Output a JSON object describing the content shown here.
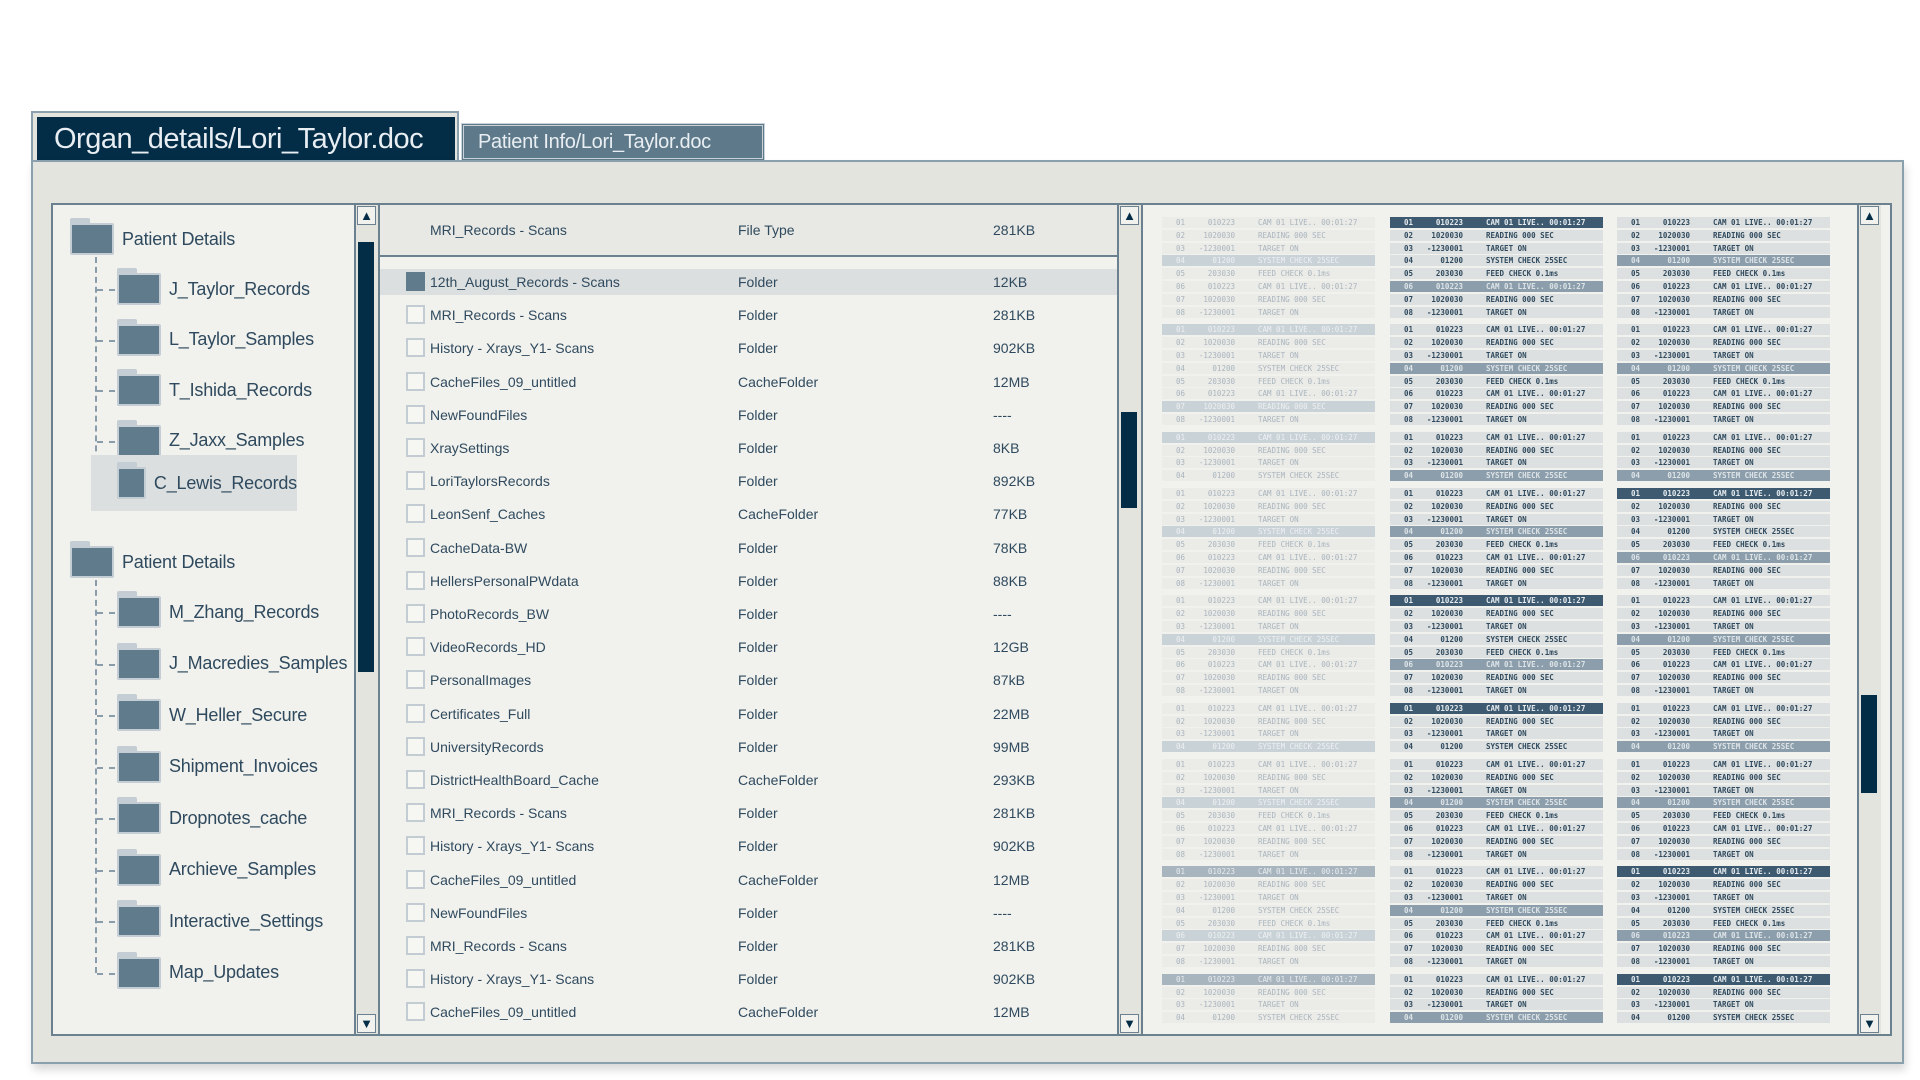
{
  "tabs": [
    {
      "label": "Organ_details/Lori_Taylor.doc",
      "active": true
    },
    {
      "label": "Patient Info/Lori_Taylor.doc",
      "active": false
    }
  ],
  "sidebar": {
    "groups": [
      {
        "label": "Patient Details",
        "children": [
          "J_Taylor_Records",
          "L_Taylor_Samples",
          "T_Ishida_Records",
          "Z_Jaxx_Samples",
          "C_Lewis_Records"
        ],
        "selected": "C_Lewis_Records"
      },
      {
        "label": "Patient Details",
        "children": [
          "M_Zhang_Records",
          "J_Macredies_Samples",
          "W_Heller_Secure",
          "Shipment_Invoices",
          "Dropnotes_cache",
          "Archieve_Samples",
          "Interactive_Settings",
          "Map_Updates"
        ]
      }
    ]
  },
  "list": {
    "header": {
      "name": "MRI_Records - Scans",
      "type": "File Type",
      "size": "281KB"
    },
    "rows": [
      {
        "name": "12th_August_Records - Scans",
        "type": "Folder",
        "size": "12KB",
        "checked": true
      },
      {
        "name": "MRI_Records - Scans",
        "type": "Folder",
        "size": "281KB"
      },
      {
        "name": "History - Xrays_Y1- Scans",
        "type": "Folder",
        "size": "902KB"
      },
      {
        "name": "CacheFiles_09_untitled",
        "type": "CacheFolder",
        "size": "12MB"
      },
      {
        "name": "NewFoundFiles",
        "type": "Folder",
        "size": "----"
      },
      {
        "name": "XraySettings",
        "type": "Folder",
        "size": "8KB"
      },
      {
        "name": "LoriTaylorsRecords",
        "type": "Folder",
        "size": "892KB"
      },
      {
        "name": "LeonSenf_Caches",
        "type": "CacheFolder",
        "size": "77KB"
      },
      {
        "name": "CacheData-BW",
        "type": "Folder",
        "size": "78KB"
      },
      {
        "name": "HellersPersonalPWdata",
        "type": "Folder",
        "size": "88KB"
      },
      {
        "name": "PhotoRecords_BW",
        "type": "Folder",
        "size": "----"
      },
      {
        "name": "VideoRecords_HD",
        "type": "Folder",
        "size": "12GB"
      },
      {
        "name": "PersonalImages",
        "type": "Folder",
        "size": "87kB"
      },
      {
        "name": "Certificates_Full",
        "type": "Folder",
        "size": "22MB"
      },
      {
        "name": "UniversityRecords",
        "type": "Folder",
        "size": "99MB"
      },
      {
        "name": "DistrictHealthBoard_Cache",
        "type": "CacheFolder",
        "size": "293KB"
      },
      {
        "name": "MRI_Records - Scans",
        "type": "Folder",
        "size": "281KB"
      },
      {
        "name": "History - Xrays_Y1- Scans",
        "type": "Folder",
        "size": "902KB"
      },
      {
        "name": "CacheFiles_09_untitled",
        "type": "CacheFolder",
        "size": "12MB"
      },
      {
        "name": "NewFoundFiles",
        "type": "Folder",
        "size": "----"
      },
      {
        "name": "MRI_Records - Scans",
        "type": "Folder",
        "size": "281KB"
      },
      {
        "name": "History - Xrays_Y1- Scans",
        "type": "Folder",
        "size": "902KB"
      },
      {
        "name": "CacheFiles_09_untitled",
        "type": "CacheFolder",
        "size": "12MB"
      }
    ]
  },
  "log_rows": [
    [
      "01",
      "010223",
      "CAM 01 LIVE.. 00:01:27"
    ],
    [
      "02",
      "1020030",
      "READING 000 SEC"
    ],
    [
      "03",
      "-1230001",
      "TARGET ON"
    ],
    [
      "04",
      "01200",
      "SYSTEM CHECK 25SEC"
    ],
    [
      "05",
      "203030",
      "FEED CHECK 0.1ms"
    ],
    [
      "06",
      "010223",
      "CAM 01 LIVE.. 00:01:27"
    ],
    [
      "07",
      "1020030",
      "READING 000 SEC"
    ],
    [
      "08",
      "-1230001",
      "TARGET ON"
    ]
  ],
  "log_columns": [
    {
      "faded": true,
      "blocks": [
        {
          "rows": 8,
          "highlight": {
            "4": "m"
          }
        },
        {
          "rows": 8,
          "highlight": {
            "1": "m",
            "7": "m"
          }
        },
        {
          "rows": 4,
          "highlight": {
            "1": "m"
          }
        },
        {
          "rows": 8,
          "highlight": {
            "4": "m"
          }
        },
        {
          "rows": 8,
          "highlight": {
            "4": "m"
          }
        },
        {
          "rows": 4,
          "highlight": {
            "4": "m"
          }
        },
        {
          "rows": 8,
          "highlight": {
            "4": "m"
          }
        },
        {
          "rows": 8,
          "highlight": {
            "1": "d",
            "6": "m"
          }
        },
        {
          "rows": 4,
          "highlight": {
            "1": "d"
          }
        }
      ]
    },
    {
      "faded": false,
      "blocks": [
        {
          "rows": 8,
          "highlight": {
            "1": "d",
            "6": "m"
          }
        },
        {
          "rows": 8,
          "highlight": {
            "4": "m"
          }
        },
        {
          "rows": 4,
          "highlight": {
            "4": "m"
          }
        },
        {
          "rows": 8,
          "highlight": {
            "4": "m"
          }
        },
        {
          "rows": 8,
          "highlight": {
            "1": "d",
            "6": "m"
          }
        },
        {
          "rows": 4,
          "highlight": {
            "1": "d"
          }
        },
        {
          "rows": 8,
          "highlight": {
            "4": "m"
          }
        },
        {
          "rows": 8,
          "highlight": {
            "4": "m"
          }
        },
        {
          "rows": 4,
          "highlight": {
            "4": "m"
          }
        }
      ]
    },
    {
      "faded": false,
      "blocks": [
        {
          "rows": 8,
          "highlight": {
            "4": "m"
          }
        },
        {
          "rows": 8,
          "highlight": {
            "4": "m"
          }
        },
        {
          "rows": 4,
          "highlight": {
            "4": "m"
          }
        },
        {
          "rows": 8,
          "highlight": {
            "1": "d",
            "6": "m"
          }
        },
        {
          "rows": 8,
          "highlight": {
            "4": "m"
          }
        },
        {
          "rows": 4,
          "highlight": {
            "4": "m"
          }
        },
        {
          "rows": 8,
          "highlight": {
            "4": "m"
          }
        },
        {
          "rows": 8,
          "highlight": {
            "1": "d",
            "6": "m"
          }
        },
        {
          "rows": 4,
          "highlight": {
            "1": "d"
          }
        }
      ]
    }
  ],
  "scroll": {
    "sidebar": 0.0,
    "list": 0.35,
    "grid": 0.6
  },
  "icons": {
    "scroll_up": "▲",
    "scroll_down": "▼"
  },
  "colors": {
    "accent": "#032c47",
    "tab_inactive": "#5e7a8a",
    "folder": "#607b8b",
    "panel_border": "#6b8190"
  }
}
